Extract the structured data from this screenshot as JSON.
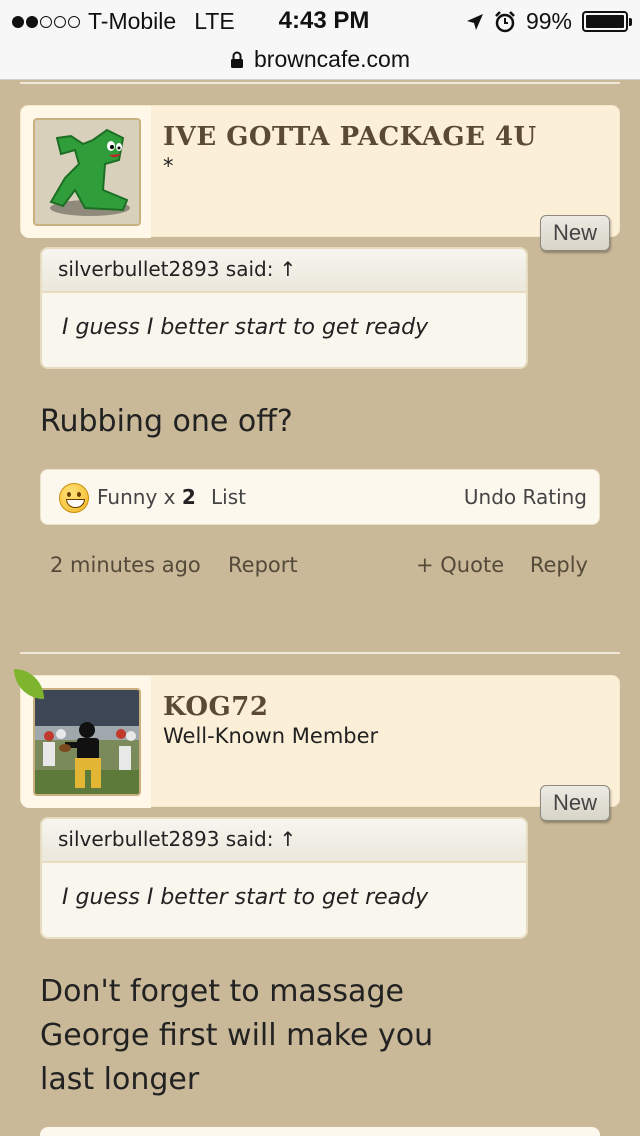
{
  "status_bar": {
    "carrier": "T-Mobile",
    "network": "LTE",
    "time": "4:43 PM",
    "battery": "99%",
    "battery_level": 0.99
  },
  "url_bar": {
    "domain": "browncafe.com"
  },
  "posts": [
    {
      "username": "IVE GOTTA PACKAGE 4U",
      "user_title": "*",
      "new_label": "New",
      "quote": {
        "author": "silverbullet2893 said:",
        "arrow": "↑",
        "text": "I guess I better start to get ready"
      },
      "message": "Rubbing one off?",
      "rating": {
        "label": "Funny x",
        "count": "2",
        "list_label": "List",
        "undo_label": "Undo Rating"
      },
      "meta": {
        "date": "2 minutes ago",
        "report_label": "Report",
        "quote_label": "+ Quote",
        "reply_label": "Reply"
      }
    },
    {
      "username": "KOG72",
      "user_title": "Well-Known Member",
      "new_label": "New",
      "quote": {
        "author": "silverbullet2893 said:",
        "arrow": "↑",
        "text": "I guess I better start to get ready"
      },
      "message_lines": [
        "Don't forget to massage",
        "George first will make you",
        "last longer"
      ]
    }
  ]
}
